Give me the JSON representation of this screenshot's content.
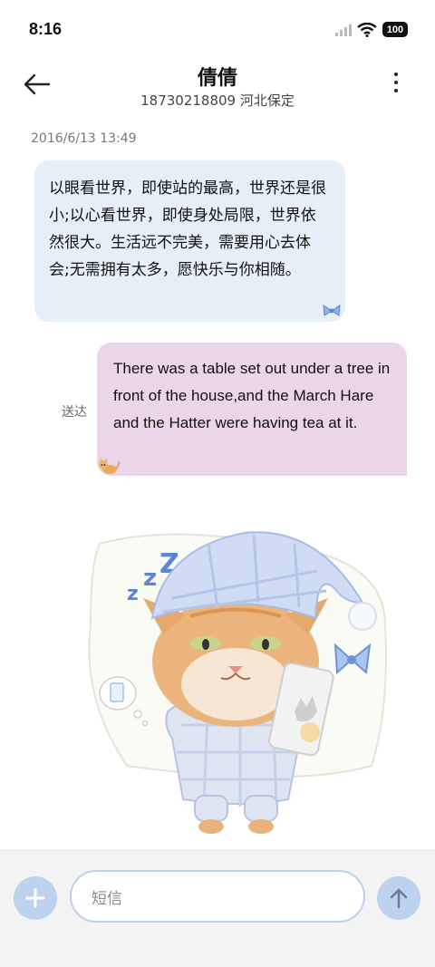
{
  "status": {
    "time": "8:16",
    "battery": "100"
  },
  "header": {
    "contact_name": "倩倩",
    "subtitle": "18730218809 河北保定"
  },
  "conversation": {
    "timestamp": "2016/6/13 13:49",
    "incoming_message": "以眼看世界，即使站的最高，世界还是很小;以心看世界，即使身处局限，世界依然很大。生活远不完美，需要用心去体会;无需拥有太多，愿快乐与你相随。",
    "outgoing_status": "送达",
    "outgoing_message": "There was a table set out under a tree in front of the house,and the March Hare and the Hatter were having tea at it."
  },
  "composer": {
    "placeholder": "短信"
  },
  "colors": {
    "accent": "#bdd2ef",
    "incoming_bubble": "#e6eef8",
    "outgoing_bubble": "#ead6e8"
  },
  "icons": {
    "back": "arrow-left-icon",
    "more": "more-vertical-icon",
    "add": "plus-icon",
    "send": "arrow-up-icon"
  }
}
